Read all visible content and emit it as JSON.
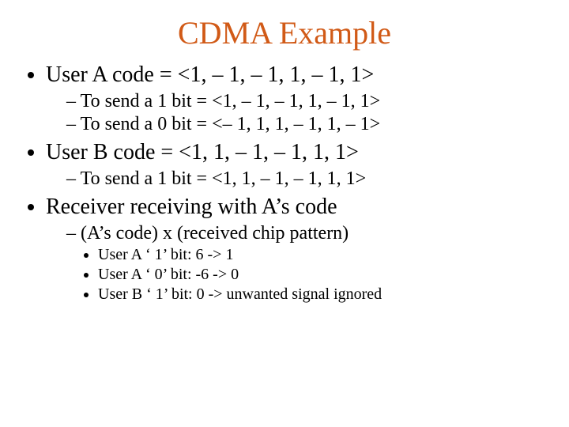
{
  "title": "CDMA Example",
  "bullets": {
    "userA": {
      "text": "User A code = <1, – 1, – 1, 1, – 1, 1>",
      "sub": [
        "To send a 1 bit = <1, – 1, – 1, 1, – 1, 1>",
        "To send a 0 bit = <– 1, 1, 1, – 1, 1, – 1>"
      ]
    },
    "userB": {
      "text": "User B code = <1, 1, – 1, – 1, 1, 1>",
      "sub": [
        "To send a 1 bit = <1, 1, – 1, – 1, 1, 1>"
      ]
    },
    "receiver": {
      "text": "Receiver receiving with A’s code",
      "sub": [
        "(A’s code) x (received chip pattern)"
      ],
      "subsub": [
        "User A ‘ 1’ bit: 6 -> 1",
        "User A ‘ 0’ bit: -6 -> 0",
        "User B ‘ 1’ bit: 0 -> unwanted signal ignored"
      ]
    }
  }
}
